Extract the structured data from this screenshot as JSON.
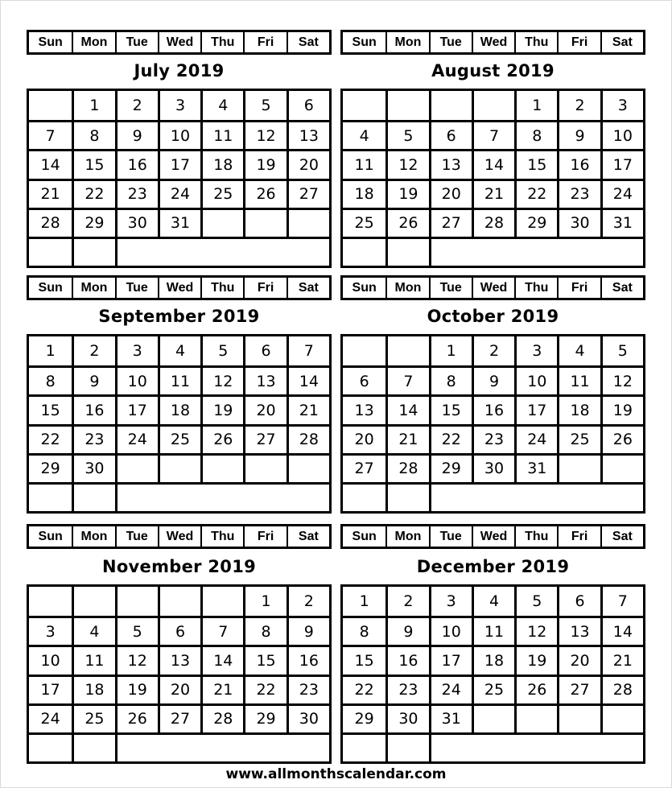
{
  "weekdays": [
    "Sun",
    "Mon",
    "Tue",
    "Wed",
    "Thu",
    "Fri",
    "Sat"
  ],
  "months": [
    {
      "title": "July 2019",
      "start": 1,
      "days": 31
    },
    {
      "title": "August 2019",
      "start": 4,
      "days": 31
    },
    {
      "title": "September 2019",
      "start": 0,
      "days": 30
    },
    {
      "title": "October 2019",
      "start": 2,
      "days": 31
    },
    {
      "title": "November 2019",
      "start": 5,
      "days": 30
    },
    {
      "title": "December 2019",
      "start": 0,
      "days": 31
    }
  ],
  "footer": {
    "website": "www.allmonthscalendar.com"
  }
}
